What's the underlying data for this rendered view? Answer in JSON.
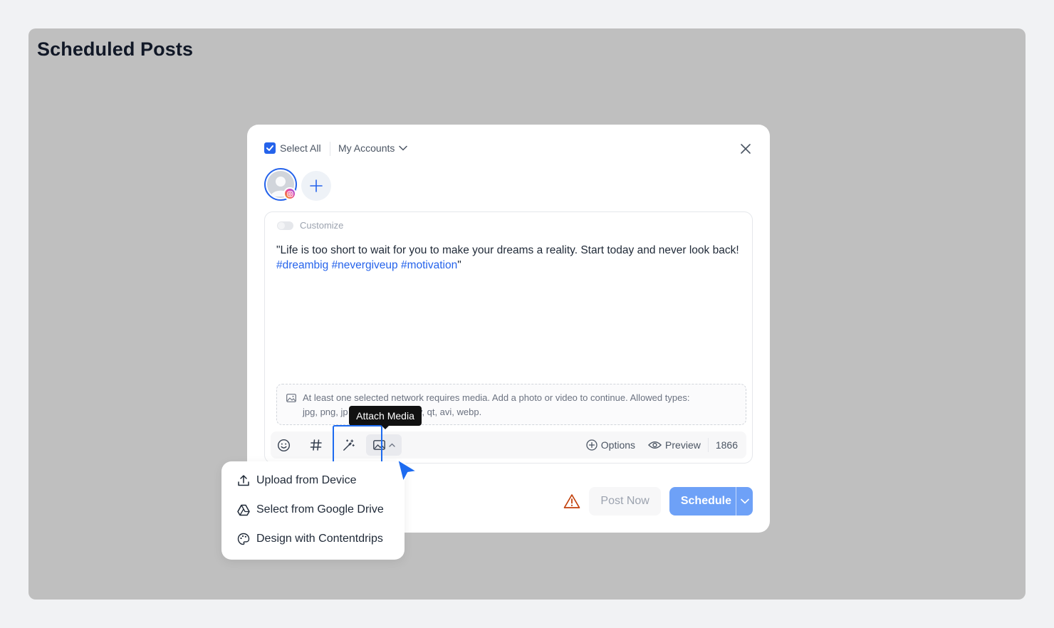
{
  "page": {
    "title": "Scheduled Posts"
  },
  "modal": {
    "select_all_label": "Select All",
    "select_all_checked": true,
    "accounts_label": "My Accounts",
    "customize_label": "Customize",
    "post_text": "\"Life is too short to wait for you to make your dreams a reality. Start today and never look back! ",
    "hashtags": [
      "#dreambig",
      "#nevergiveup",
      "#motivation"
    ],
    "post_text_end": "\"",
    "media_notice_line1": "At least one selected network requires media. Add a photo or video to continue. Allowed types:",
    "media_notice_prefix": "jpg, png, jp",
    "media_notice_suffix": "ov, qt, avi, webp.",
    "toolbar": {
      "options_label": "Options",
      "preview_label": "Preview",
      "char_count": "1866",
      "icons": [
        "emoji-icon",
        "hashtag-icon",
        "magic-wand-icon",
        "image-icon"
      ]
    },
    "tooltip": "Attach Media",
    "post_now_label": "Post Now",
    "schedule_label": "Schedule"
  },
  "media_menu": {
    "items": [
      {
        "label": "Upload from Device",
        "icon": "upload-icon"
      },
      {
        "label": "Select from Google Drive",
        "icon": "google-drive-icon"
      },
      {
        "label": "Design with Contentdrips",
        "icon": "palette-icon"
      }
    ]
  },
  "colors": {
    "accent": "#2563eb",
    "schedule_button": "#6ea1f7",
    "overlay": "#bfbfbf",
    "warning": "#c2410c"
  }
}
